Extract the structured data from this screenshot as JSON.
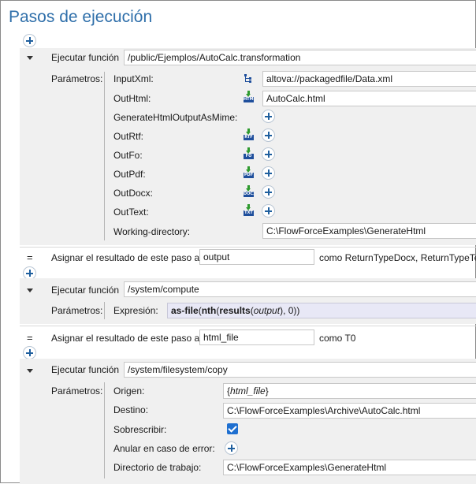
{
  "title": "Pasos de ejecución",
  "step1": {
    "label": "Ejecutar función",
    "function": "/public/Ejemplos/AutoCalc.transformation",
    "params_label": "Parámetros:",
    "params": [
      {
        "name": "InputXml:",
        "icon": "xml-tree-icon",
        "value": "altova://packagedfile/Data.xml"
      },
      {
        "name": "OutHtml:",
        "icon": "html-output-icon",
        "tag": "HTML",
        "value": "AutoCalc.html"
      },
      {
        "name": "GenerateHtmlOutputAsMime:"
      },
      {
        "name": "OutRtf:",
        "icon": "rtf-output-icon",
        "tag": "RTF"
      },
      {
        "name": "OutFo:",
        "icon": "fo-output-icon",
        "tag": "FO"
      },
      {
        "name": "OutPdf:",
        "icon": "pdf-output-icon",
        "tag": "PDF"
      },
      {
        "name": "OutDocx:",
        "icon": "docx-output-icon",
        "tag": "DOCX"
      },
      {
        "name": "OutText:",
        "icon": "text-output-icon",
        "tag": "TXT"
      },
      {
        "name": "Working-directory:",
        "value": "C:\\FlowForceExamples\\GenerateHtml"
      }
    ]
  },
  "assign1": {
    "symbol": "=",
    "label": "Asignar el resultado de este paso a",
    "value": "output",
    "type_text": "como ReturnTypeDocx, ReturnTypeText"
  },
  "step2": {
    "label": "Ejecutar función",
    "function": "/system/compute",
    "params_label": "Parámetros:",
    "expr_label": "Expresión:",
    "expr": {
      "p1": "as-file",
      "p2": "(",
      "p3": "nth",
      "p4": "(",
      "p5": "results",
      "p6": "(",
      "p7": "output",
      "p8": "), 0))"
    }
  },
  "assign2": {
    "symbol": "=",
    "label": "Asignar el resultado de este paso a",
    "value": "html_file",
    "type_text": "como T0"
  },
  "step3": {
    "label": "Ejecutar función",
    "function": "/system/filesystem/copy",
    "params_label": "Parámetros:",
    "origen_label": "Origen:",
    "origen_brace_open": "{",
    "origen_var": "html_file",
    "origen_brace_close": "}",
    "destino_label": "Destino:",
    "destino_value": "C:\\FlowForceExamples\\Archive\\AutoCalc.html",
    "sobrescribir_label": "Sobrescribir:",
    "anular_label": "Anular en caso de error:",
    "directorio_label": "Directorio de trabajo:",
    "directorio_value": "C:\\FlowForceExamples\\GenerateHtml"
  },
  "colors": {
    "title": "#2f6faa",
    "accent": "#1f5f9e",
    "checkbox": "#1e6fd0"
  }
}
